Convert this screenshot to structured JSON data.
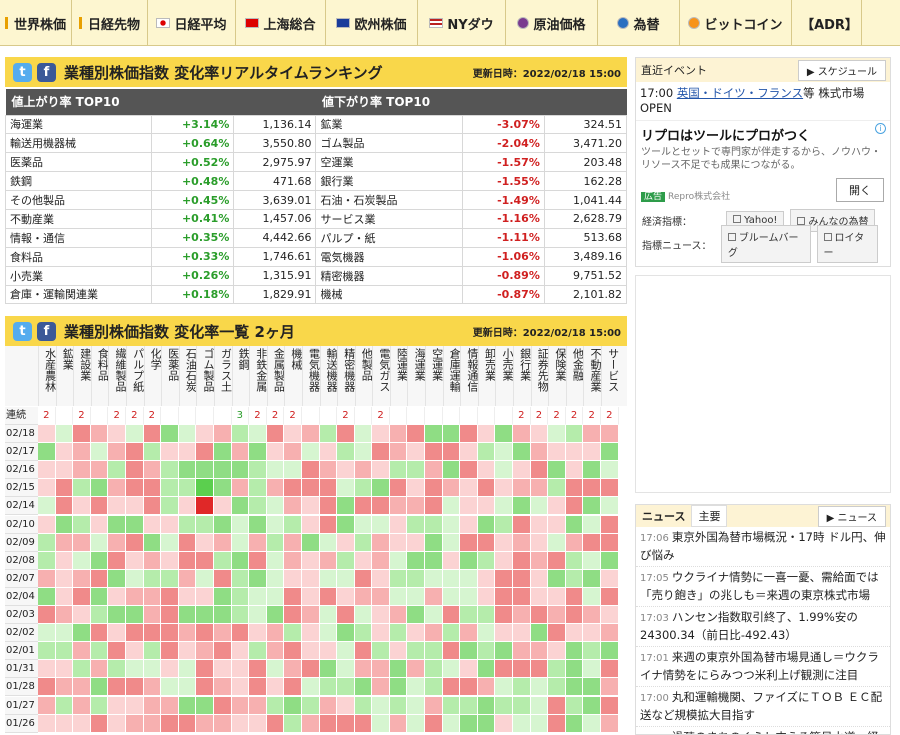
{
  "nav": [
    {
      "label": "世界株価",
      "icon": "bar-icon",
      "w": 72
    },
    {
      "label": "日経先物",
      "icon": "bar-icon",
      "w": 76
    },
    {
      "label": "日経平均",
      "icon": "japan-flag-icon",
      "w": 88
    },
    {
      "label": "上海総合",
      "icon": "china-flag-icon",
      "w": 90
    },
    {
      "label": "欧州株価",
      "icon": "eu-flag-icon",
      "w": 92
    },
    {
      "label": "NYダウ",
      "icon": "us-flag-icon",
      "w": 88
    },
    {
      "label": "原油価格",
      "icon": "oil-drop-icon",
      "w": 92
    },
    {
      "label": "為替",
      "icon": "currency-icon",
      "w": 82
    },
    {
      "label": "ビットコイン",
      "icon": "bitcoin-icon",
      "w": 112
    },
    {
      "label": "【ADR】",
      "icon": "bar-icon",
      "w": 70
    }
  ],
  "ranking": {
    "title": "業種別株価指数 変化率リアルタイムランキング",
    "updated": "更新日時：2022/02/18 15:00",
    "up_header": "値上がり率 TOP10",
    "down_header": "値下がり率 TOP10",
    "rows": [
      {
        "up_name": "海運業",
        "up_pct": "+3.14%",
        "up_val": "1,136.14",
        "dn_name": "鉱業",
        "dn_pct": "-3.07%",
        "dn_val": "324.51"
      },
      {
        "up_name": "輸送用機器械",
        "up_pct": "+0.64%",
        "up_val": "3,550.80",
        "dn_name": "ゴム製品",
        "dn_pct": "-2.04%",
        "dn_val": "3,471.20"
      },
      {
        "up_name": "医薬品",
        "up_pct": "+0.52%",
        "up_val": "2,975.97",
        "dn_name": "空運業",
        "dn_pct": "-1.57%",
        "dn_val": "203.48"
      },
      {
        "up_name": "鉄鋼",
        "up_pct": "+0.48%",
        "up_val": "471.68",
        "dn_name": "銀行業",
        "dn_pct": "-1.55%",
        "dn_val": "162.28"
      },
      {
        "up_name": "その他製品",
        "up_pct": "+0.45%",
        "up_val": "3,639.01",
        "dn_name": "石油・石炭製品",
        "dn_pct": "-1.49%",
        "dn_val": "1,041.44"
      },
      {
        "up_name": "不動産業",
        "up_pct": "+0.41%",
        "up_val": "1,457.06",
        "dn_name": "サービス業",
        "dn_pct": "-1.16%",
        "dn_val": "2,628.79"
      },
      {
        "up_name": "情報・通信",
        "up_pct": "+0.35%",
        "up_val": "4,442.66",
        "dn_name": "パルプ・紙",
        "dn_pct": "-1.11%",
        "dn_val": "513.68"
      },
      {
        "up_name": "食料品",
        "up_pct": "+0.33%",
        "up_val": "1,746.61",
        "dn_name": "電気機器",
        "dn_pct": "-1.06%",
        "dn_val": "3,489.16"
      },
      {
        "up_name": "小売業",
        "up_pct": "+0.26%",
        "up_val": "1,315.91",
        "dn_name": "精密機器",
        "dn_pct": "-0.89%",
        "dn_val": "9,751.52"
      },
      {
        "up_name": "倉庫・運輸関連業",
        "up_pct": "+0.18%",
        "up_val": "1,829.91",
        "dn_name": "機械",
        "dn_pct": "-0.87%",
        "dn_val": "2,101.82"
      }
    ]
  },
  "heatmap": {
    "title": "業種別株価指数 変化率一覧 2ヶ月",
    "updated": "更新日時：2022/02/18 15:00",
    "streak_label": "連続",
    "columns": [
      "水産農林",
      "鉱業",
      "建設業",
      "食料品",
      "繊維製品",
      "パルプ紙",
      "化学",
      "医薬品",
      "石油石炭",
      "ゴム製品",
      "ガラス土",
      "鉄鋼",
      "非鉄金属",
      "金属製品",
      "機械",
      "電気機器",
      "輸送機器",
      "精密機器",
      "他製品",
      "電気ガス",
      "陸運業",
      "海運業",
      "空運業",
      "倉庫運輸",
      "情報通信",
      "卸売業",
      "小売業",
      "銀行業",
      "証券先物",
      "保険業",
      "他金融",
      "不動産業",
      "サービス"
    ],
    "streak": [
      "2",
      "",
      "2",
      "",
      "2",
      "2",
      "2",
      "",
      "",
      "",
      "",
      "3",
      "2",
      "2",
      "2",
      "",
      "",
      "2",
      "",
      "2",
      "",
      "",
      "",
      "",
      "",
      "",
      "",
      "2",
      "2",
      "2",
      "2",
      "2",
      "2"
    ],
    "dates": [
      "02/18",
      "02/17",
      "02/16",
      "02/15",
      "02/14",
      "02/10",
      "02/09",
      "02/08",
      "02/07",
      "02/04",
      "02/03",
      "02/02",
      "02/01",
      "01/31",
      "01/28",
      "01/27",
      "01/26"
    ]
  },
  "events": {
    "header": "直近イベント",
    "schedule_btn": "スケジュール",
    "time": "17:00",
    "link": "英国・ドイツ・フランス",
    "rest": "等 株式市場OPEN"
  },
  "ad": {
    "title": "リプロはツールにプロがつく",
    "body": "ツールとセットで専門家が伴走するから、ノウハウ・リソース不足でも成果につながる。",
    "badge": "広告",
    "sponsor": "Repro株式会社",
    "open": "開く"
  },
  "indicators": {
    "econ_label": "経済指標：",
    "econ_btns": [
      "Yahoo!",
      "みんなの為替"
    ],
    "news_label": "指標ニュース：",
    "news_btns": [
      "ブルームバーグ",
      "ロイター"
    ]
  },
  "news": {
    "tab1": "ニュース",
    "tab2": "主要",
    "btn": "ニュース",
    "items": [
      {
        "time": "17:06",
        "text": "東京外国為替市場概況・17時 ドル円、伸び悩み"
      },
      {
        "time": "17:05",
        "text": "ウクライナ情勢に一喜一憂、需給面では「売り飽き」の兆しも＝来週の東京株式市場"
      },
      {
        "time": "17:03",
        "text": "ハンセン指数取引終了、1.99%安の24300.34（前日比-492.43）"
      },
      {
        "time": "17:01",
        "text": "来週の東京外国為替市場見通し＝ウクライナ情勢をにらみつつ米利上げ観測に注目"
      },
      {
        "time": "17:00",
        "text": "丸和運輸機関、ファイズにＴＯＢ ＥＣ配送など規模拡大目指す"
      },
      {
        "time": "17:00",
        "text": "過疎のまちのくらし支える簡易水道、経"
      }
    ]
  },
  "colors": {
    "nav_bg": "#fdf6d0",
    "panel_head": "#f9d74a",
    "up": "#2a9d2a",
    "down": "#d02020"
  }
}
